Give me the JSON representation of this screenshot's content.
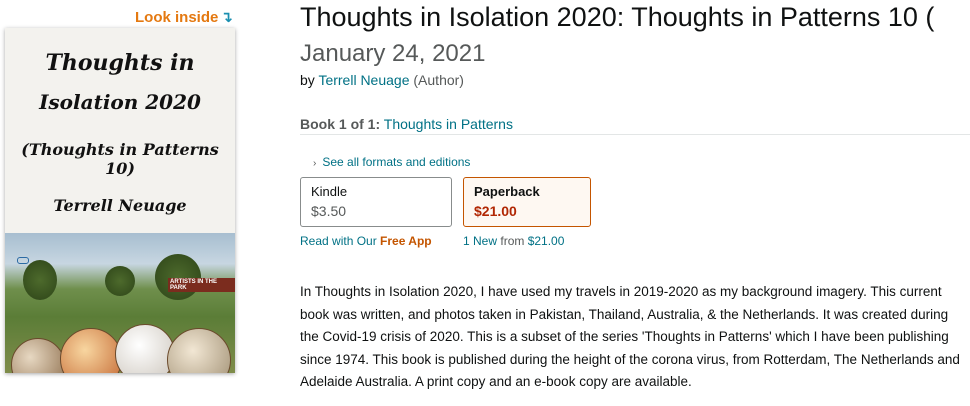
{
  "look_inside": {
    "label": "Look inside",
    "arrow": "↴"
  },
  "cover": {
    "line1": "Thoughts in",
    "line2": "Isolation 2020",
    "line3": "(Thoughts in Patterns 10)",
    "line4": "Terrell Neuage",
    "banner": "ARTISTS IN THE PARK"
  },
  "product": {
    "title": "Thoughts in Isolation 2020: Thoughts in Patterns 10 (",
    "date": "January 24, 2021",
    "by_prefix": "by",
    "author": "Terrell Neuage",
    "author_role": "(Author)",
    "series_label": "Book 1 of 1:",
    "series_name": "Thoughts in Patterns"
  },
  "formats": {
    "see_all": "See all formats and editions",
    "kindle": {
      "name": "Kindle",
      "price": "$3.50",
      "sub_prefix": "Read with Our",
      "sub_link": "Free App"
    },
    "paperback": {
      "name": "Paperback",
      "price": "$21.00",
      "sub_new": "1 New",
      "sub_from": "from",
      "sub_price": "$21.00"
    }
  },
  "description": "In Thoughts in Isolation 2020, I have used my travels in 2019-2020 as my background imagery. This current book was written, and photos taken in Pakistan, Thailand, Australia, & the Netherlands. It was created during the Covid-19 crisis of 2020. This is a subset of the series 'Thoughts in Patterns' which I have been publishing since 1974. This book is published during the height of the corona virus, from Rotterdam, The Netherlands and Adelaide Australia. A print copy and an e-book copy are available.",
  "colors": {
    "link": "#007185",
    "look_inside": "#e47911",
    "selected_border": "#c45500",
    "price_red": "#b12704"
  }
}
